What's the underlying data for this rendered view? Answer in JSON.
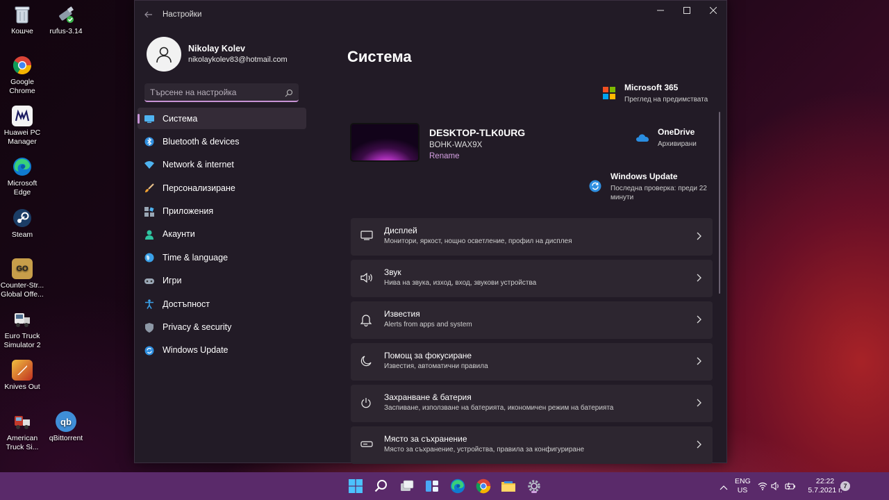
{
  "desktop": {
    "icons": [
      {
        "label": "Кошче"
      },
      {
        "label": "rufus-3.14"
      },
      {
        "label": "Google Chrome"
      },
      {
        "label": "Huawei PC Manager"
      },
      {
        "label": "Microsoft Edge"
      },
      {
        "label": "Steam"
      },
      {
        "label": "Counter-Str... Global Offe..."
      },
      {
        "label": "Euro Truck Simulator 2"
      },
      {
        "label": "Knives Out"
      },
      {
        "label": "American Truck Si..."
      },
      {
        "label": "qBittorrent"
      }
    ]
  },
  "window": {
    "title": "Настройки",
    "profile": {
      "name": "Nikolay Kolev",
      "email": "nikolaykolev83@hotmail.com"
    },
    "search": {
      "placeholder": "Търсене на настройка"
    },
    "nav": [
      {
        "label": "Система",
        "active": true,
        "icon": "system-icon"
      },
      {
        "label": "Bluetooth & devices",
        "icon": "bluetooth-icon"
      },
      {
        "label": "Network & internet",
        "icon": "wifi-icon"
      },
      {
        "label": "Персонализиране",
        "icon": "brush-icon"
      },
      {
        "label": "Приложения",
        "icon": "apps-icon"
      },
      {
        "label": "Акаунти",
        "icon": "accounts-icon"
      },
      {
        "label": "Time & language",
        "icon": "globe-icon"
      },
      {
        "label": "Игри",
        "icon": "gamepad-icon"
      },
      {
        "label": "Достъпност",
        "icon": "accessibility-icon"
      },
      {
        "label": "Privacy & security",
        "icon": "shield-icon"
      },
      {
        "label": "Windows Update",
        "icon": "update-icon"
      }
    ],
    "content": {
      "title": "Система",
      "device": {
        "name": "DESKTOP-TLK0URG",
        "model": "BOHK-WAX9X",
        "rename": "Rename"
      },
      "quick": {
        "m365": {
          "title": "Microsoft 365",
          "sub": "Преглед на предимствата"
        },
        "onedrive": {
          "title": "OneDrive",
          "sub": "Архивирани"
        },
        "update": {
          "title": "Windows Update",
          "sub": "Последна проверка: преди 22 минути"
        }
      },
      "cards": [
        {
          "title": "Дисплей",
          "sub": "Монитори, яркост, нощно осветление, профил на дисплея",
          "icon": "display-icon"
        },
        {
          "title": "Звук",
          "sub": "Нива на звука, изход, вход, звукови устройства",
          "icon": "speaker-icon"
        },
        {
          "title": "Известия",
          "sub": "Alerts from apps and system",
          "icon": "bell-icon"
        },
        {
          "title": "Помощ за фокусиране",
          "sub": "Известия, автоматични правила",
          "icon": "moon-icon"
        },
        {
          "title": "Захранване & батерия",
          "sub": "Заспиване, използване на батерията, икономичен режим на батерията",
          "icon": "power-icon"
        },
        {
          "title": "Място за съхранение",
          "sub": "Място за съхранение, устройства, правила за конфигуриране",
          "icon": "storage-icon"
        }
      ]
    }
  },
  "taskbar": {
    "lang_top": "ENG",
    "lang_bottom": "US",
    "time": "22:22",
    "date": "5.7.2021 г.",
    "notifications": "7"
  },
  "colors": {
    "accent": "#c893d6",
    "window_bg": "#221b26",
    "card_bg": "#2d2630",
    "taskbar": "#5a2a6a"
  }
}
